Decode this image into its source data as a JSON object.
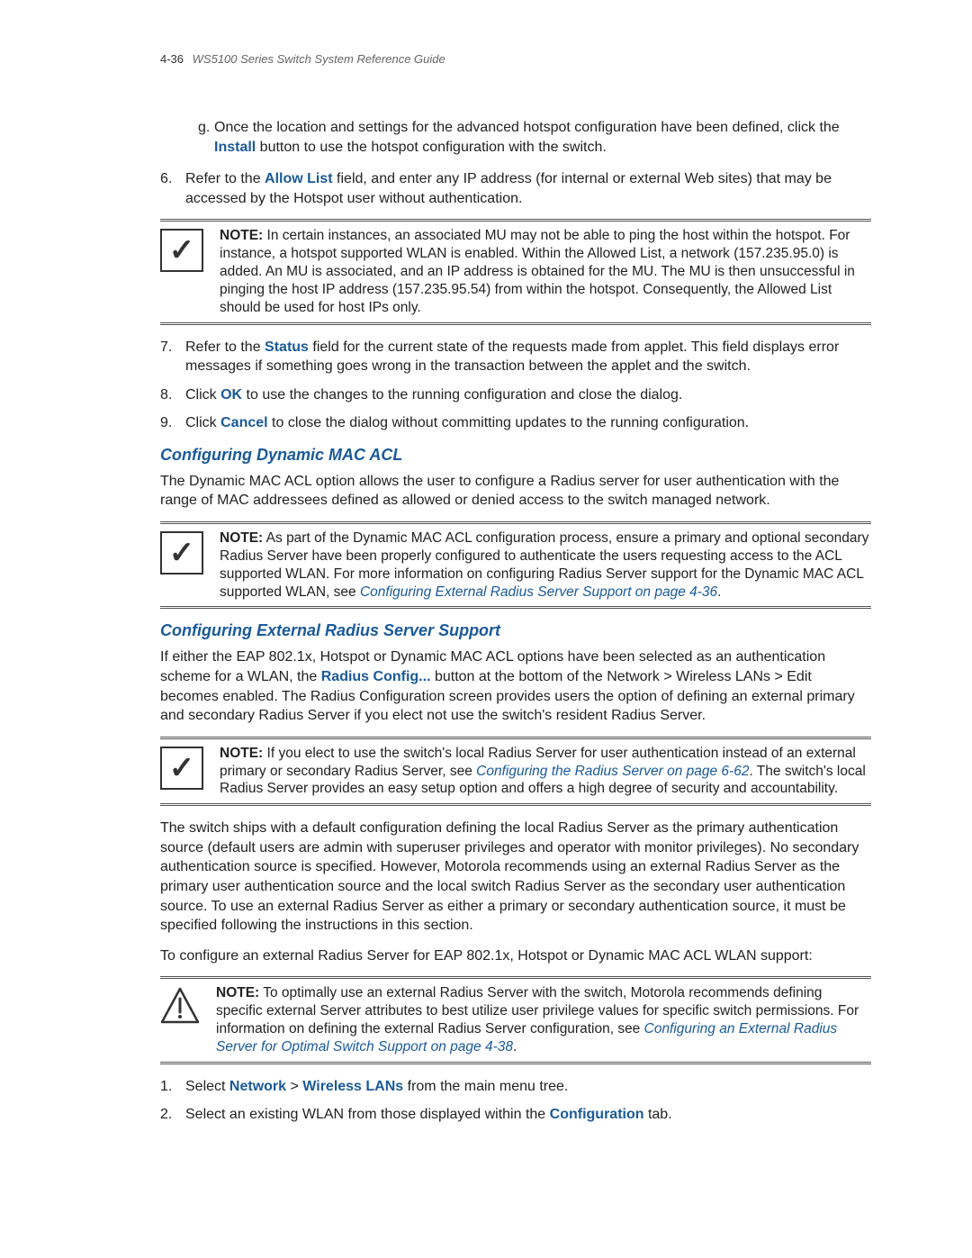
{
  "header": {
    "page_num": "4-36",
    "doc_title": "WS5100 Series Switch System Reference Guide"
  },
  "intro_sub": {
    "letter": "g.",
    "text_before": "Once the location and settings for the advanced hotspot configuration have been defined, click the ",
    "install": "Install",
    "text_after": " button to use the hotspot configuration with the switch."
  },
  "step6": {
    "num": "6.",
    "t1": "Refer to the ",
    "allow_list": "Allow List",
    "t2": " field, and enter any IP address (for internal or external Web sites) that may be accessed by the Hotspot user without authentication."
  },
  "note1": {
    "label": "NOTE:",
    "text": " In certain instances, an associated MU may not be able to ping the host within the hotspot. For instance, a hotspot supported WLAN is enabled. Within the Allowed List, a network (157.235.95.0) is added. An MU is associated, and an IP address is obtained for the MU. The MU is then unsuccessful in pinging the host IP address (157.235.95.54) from within the hotspot. Consequently, the Allowed List should be used for host IPs only."
  },
  "step7": {
    "num": "7.",
    "t1": "Refer to the ",
    "status": "Status",
    "t2": " field for the current state of the requests made from applet. This field displays error messages if something goes wrong in the transaction between the applet and the switch."
  },
  "step8": {
    "num": "8.",
    "t1": "Click ",
    "ok": "OK",
    "t2": " to use the changes to the running configuration and close the dialog."
  },
  "step9": {
    "num": "9.",
    "t1": "Click ",
    "cancel": "Cancel",
    "t2": " to close the dialog without committing updates to the running configuration."
  },
  "heading1": "Configuring Dynamic MAC ACL",
  "para1": "The Dynamic MAC ACL option allows the user to configure a Radius server for user authentication with the range of MAC addressees defined as allowed or denied access to the switch managed network.",
  "note2": {
    "label": "NOTE:",
    "t1": " As part of the Dynamic MAC ACL configuration process, ensure a primary and optional secondary Radius Server have been properly configured to authenticate the users requesting access to the ACL supported WLAN. For more information on configuring Radius Server support for the Dynamic MAC ACL supported WLAN, see ",
    "link": "Configuring External Radius Server Support on page 4-36",
    "t2": "."
  },
  "heading2": "Configuring External Radius Server Support",
  "para2": {
    "t1": "If either the EAP 802.1x, Hotspot or Dynamic MAC ACL options have been selected as an authentication scheme for a WLAN, the ",
    "radius": "Radius Config...",
    "t2": " button at the bottom of the Network > Wireless LANs > Edit becomes enabled. The Radius Configuration screen provides users the option of defining an external primary and secondary Radius Server if you elect not use the switch's resident Radius Server."
  },
  "note3": {
    "label": "NOTE:",
    "t1": " If you elect to use the switch's local Radius Server for user authentication instead of an external primary or secondary Radius Server, see ",
    "link": "Configuring the Radius Server on page 6-62",
    "t2": ". The switch's local Radius Server provides an easy setup option and offers a high degree of security and accountability."
  },
  "para3": "The switch ships with a default configuration defining the local Radius Server as the primary authentication source (default users are admin with superuser privileges and operator with monitor privileges). No secondary authentication source is specified. However, Motorola recommends using an external Radius Server as the primary user authentication source and the local switch Radius Server as the secondary user authentication source. To use an external Radius Server as either a primary or secondary authentication source, it must be specified following the instructions in this section.",
  "para4": "To configure an external Radius Server for EAP 802.1x, Hotspot or Dynamic MAC ACL WLAN support:",
  "note4": {
    "label": "NOTE:",
    "t1": " To optimally use an external Radius Server with the switch, Motorola recommends defining specific external Server attributes to best utilize user privilege values for specific switch permissions. For information on defining the external Radius Server configuration, see ",
    "link": "Configuring an External Radius Server for Optimal Switch Support on page 4-38",
    "t2": "."
  },
  "stepA": {
    "num": "1.",
    "t1": "Select ",
    "network": "Network",
    "gt": " > ",
    "wlan": "Wireless LANs",
    "t2": " from the main menu tree."
  },
  "stepB": {
    "num": "2.",
    "t1": "Select an existing WLAN from those displayed within the ",
    "conf": "Configuration",
    "t2": " tab."
  }
}
